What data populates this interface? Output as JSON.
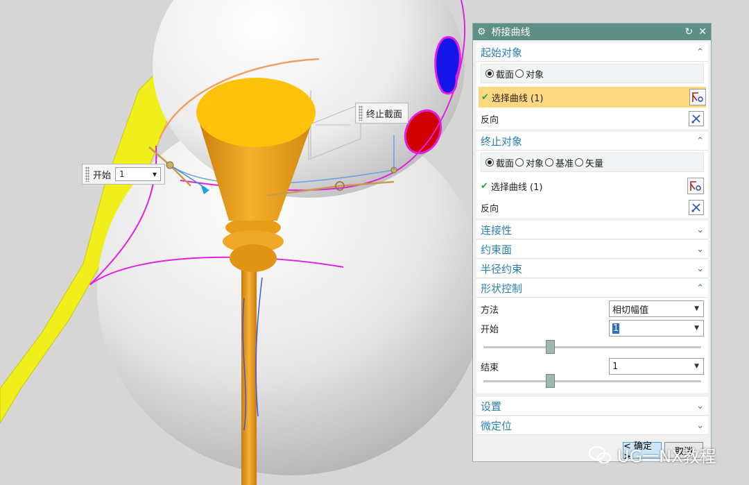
{
  "viewport": {
    "start_label": "开始",
    "start_value": "1",
    "end_label": "终止截面"
  },
  "dialog": {
    "title": "桥接曲线",
    "sections": {
      "start_object": {
        "title": "起始对象",
        "options": [
          "截面",
          "对象"
        ],
        "selected": "截面",
        "select_curve": "选择曲线 (1)",
        "reverse": "反向"
      },
      "end_object": {
        "title": "终止对象",
        "options": [
          "截面",
          "对象",
          "基准",
          "矢量"
        ],
        "selected": "截面",
        "select_curve": "选择曲线 (1)",
        "reverse": "反向"
      },
      "connectivity": {
        "title": "连接性"
      },
      "constraint_face": {
        "title": "约束面"
      },
      "radius_constraint": {
        "title": "半径约束"
      },
      "shape_control": {
        "title": "形状控制",
        "method_label": "方法",
        "method_value": "相切幅值",
        "start_label": "开始",
        "start_value": "1",
        "start_slider": 0.3,
        "end_label": "结束",
        "end_value": "1",
        "end_slider": 0.3
      },
      "settings": {
        "title": "设置"
      },
      "fine_position": {
        "title": "微定位"
      }
    },
    "ok_label": "< 确定 >",
    "cancel_label": "取消"
  },
  "watermark": "UG一NX教程",
  "colors": {
    "title_bar": "#5d8f86",
    "section_title": "#2a7fb0",
    "highlight_row": "#ffd882",
    "broom": "#f2a51c",
    "yellow_surface": "#f0ef1c",
    "magenta_curve": "#e020e0"
  }
}
